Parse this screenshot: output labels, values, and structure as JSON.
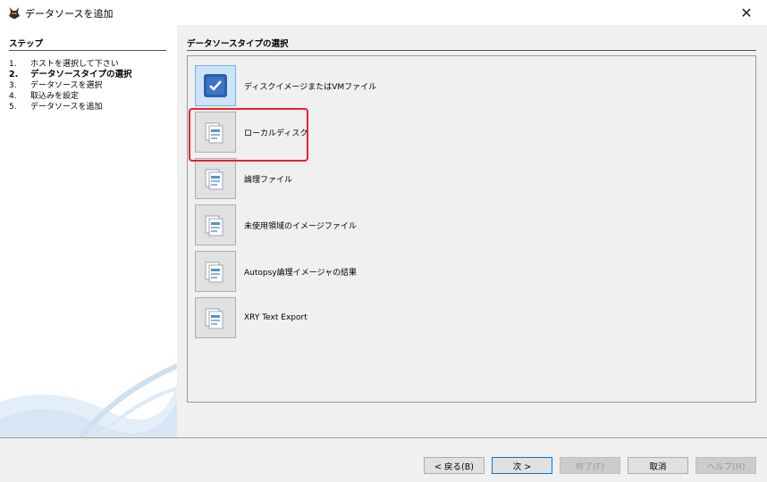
{
  "window": {
    "title": "データソースを追加",
    "close_glyph": "✕",
    "icon": "autopsy-dog-icon"
  },
  "steps": {
    "heading": "ステップ",
    "items": [
      {
        "num": "1.",
        "label": "ホストを選択して下さい"
      },
      {
        "num": "2.",
        "label": "データソースタイプの選択"
      },
      {
        "num": "3.",
        "label": "データソースを選択"
      },
      {
        "num": "4.",
        "label": "取込みを設定"
      },
      {
        "num": "5.",
        "label": "データソースを追加"
      }
    ],
    "active_index": 1
  },
  "main": {
    "heading": "データソースタイプの選択",
    "types": [
      {
        "label": "ディスクイメージまたはVMファイル",
        "icon": "disk-image-icon",
        "selected": true
      },
      {
        "label": "ローカルディスク",
        "icon": "local-disk-icon",
        "selected": false
      },
      {
        "label": "論理ファイル",
        "icon": "logical-files-icon",
        "selected": false
      },
      {
        "label": "未使用領域のイメージファイル",
        "icon": "unallocated-image-icon",
        "selected": false
      },
      {
        "label": "Autopsy論理イメージャの結果",
        "icon": "logical-imager-icon",
        "selected": false
      },
      {
        "label": "XRY Text Export",
        "icon": "xry-export-icon",
        "selected": false
      }
    ]
  },
  "footer": {
    "back": "< 戻る(B)",
    "next": "次 >",
    "finish": "終了(F)",
    "cancel": "取消",
    "help": "ヘルプ(H)"
  },
  "colors": {
    "highlight": "#e8232b",
    "selected_bg": "#cce4f7",
    "accent": "#0078d7"
  }
}
